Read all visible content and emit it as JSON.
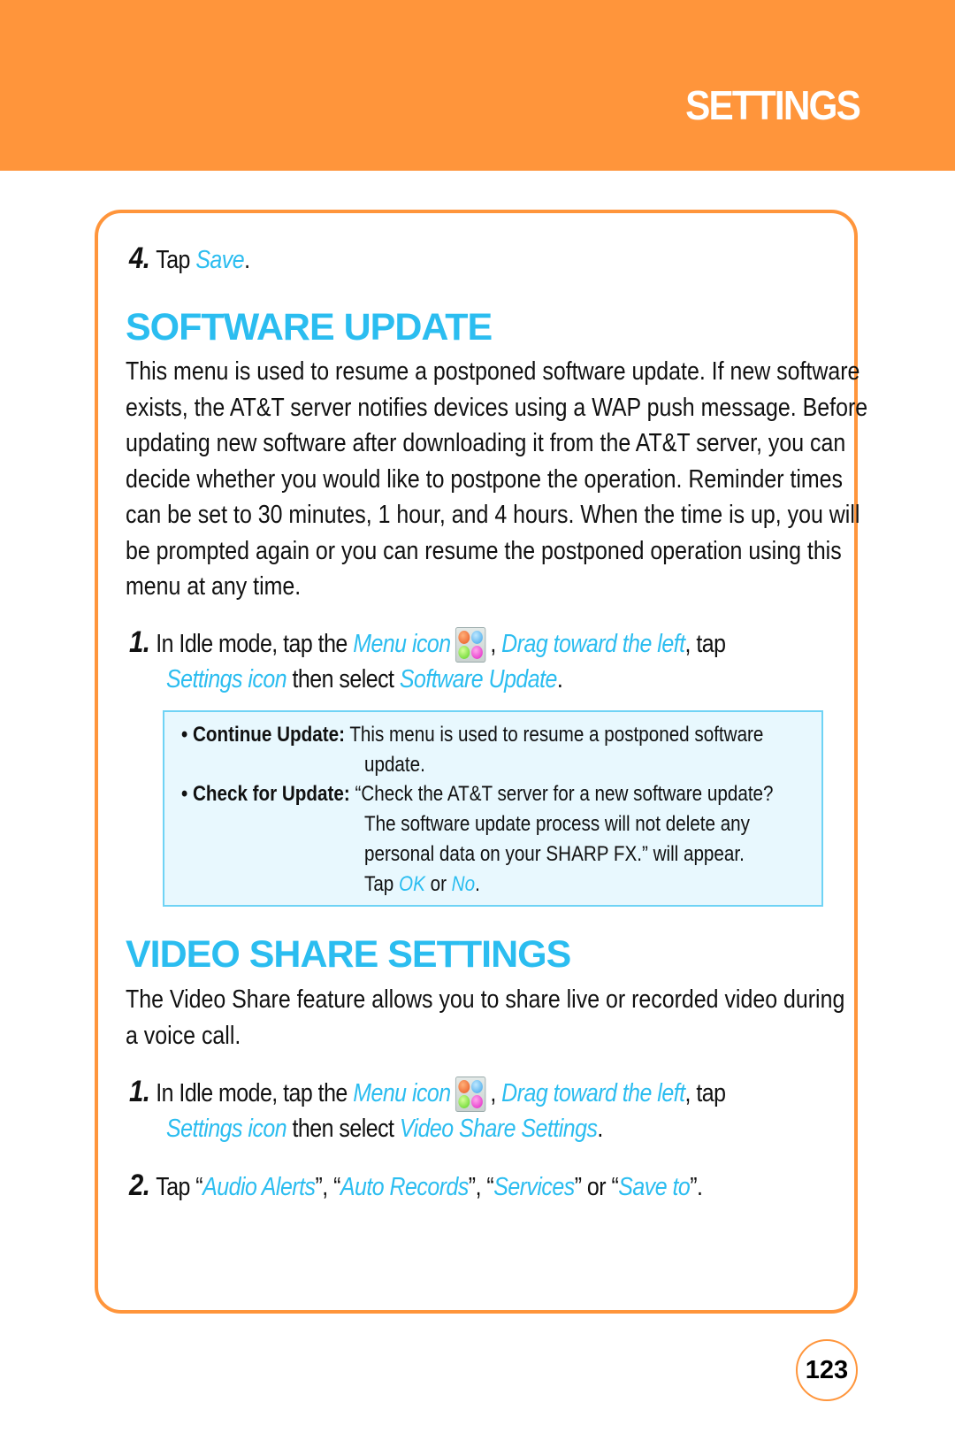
{
  "header": {
    "title": "SETTINGS",
    "color": "#ff953b"
  },
  "step4": {
    "number": "4.",
    "text": "Tap ",
    "link": "Save",
    "end": "."
  },
  "software_update": {
    "title": "SOFTWARE UPDATE",
    "paragraph_lines": [
      "This menu is used to resume a postponed software update. If new software",
      "exists, the AT&T server notifies devices using a WAP push message. Before",
      "updating new software after downloading it from the AT&T server, you can",
      "decide whether you would like to postpone the operation. Reminder times",
      "can be set to 30 minutes, 1 hour, and 4 hours. When the time is up, you will",
      "be prompted again or you can resume the postponed operation using this",
      "menu at any time."
    ],
    "step1": {
      "number": "1.",
      "t1": "In Idle mode, tap the ",
      "menu_icon": "Menu icon",
      "t2": ", ",
      "drag": "Drag toward the left",
      "t3": ", tap",
      "settings_icon": "Settings icon",
      "t4": " then select ",
      "target": "Software Update",
      "end": "."
    },
    "options": [
      {
        "label": "Continue Update:",
        "lines": [
          "This menu is used to resume a postponed software",
          "update."
        ]
      },
      {
        "label": "Check for Update:",
        "lines": [
          "“Check the AT&T server for a new software update?",
          "The software update process will not delete any",
          "personal data on your SHARP FX.” will appear."
        ],
        "tap": "Tap ",
        "ok": "OK",
        "or": " or ",
        "no": "No",
        "end": "."
      }
    ]
  },
  "video_share": {
    "title": "VIDEO SHARE SETTINGS",
    "paragraph_lines": [
      "The Video Share feature allows you to share live or recorded video during",
      "a voice call."
    ],
    "step1": {
      "number": "1.",
      "t1": "In Idle mode, tap the ",
      "menu_icon": "Menu icon",
      "t2": ", ",
      "drag": "Drag toward the left",
      "t3": ", tap",
      "settings_icon": "Settings icon",
      "t4": " then select ",
      "target": "Video Share Settings",
      "end": "."
    },
    "step2": {
      "number": "2.",
      "t1": "Tap “",
      "a": "Audio Alerts",
      "s1": "”, “",
      "b": "Auto Records",
      "s2": "”, “",
      "c": "Services",
      "s3": "” or “",
      "d": "Save to",
      "end": "”."
    }
  },
  "page_number": "123"
}
